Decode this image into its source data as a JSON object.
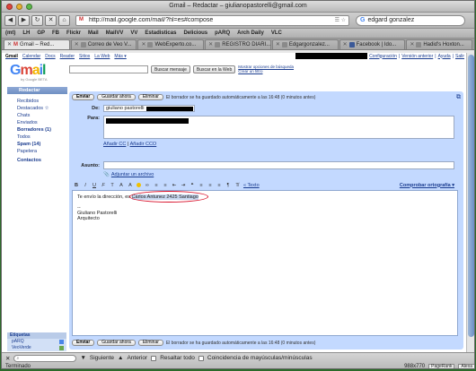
{
  "window": {
    "title": "Gmail – Redactar – giulianopastorelli@gmail.com"
  },
  "toolbar": {
    "url": "http://mail.google.com/mail/?hl=es#compose",
    "search_value": "edgard gonzalez"
  },
  "bookmarks": [
    "(mt)",
    "LH",
    "GP",
    "FB",
    "Flickr",
    "Mail",
    "MailVV",
    "VV",
    "Estadisticas",
    "Delicious",
    "pARQ",
    "Arch Daily",
    "VLC"
  ],
  "tabs": [
    {
      "label": "Gmail – Red...",
      "active": true
    },
    {
      "label": "Correo de Veo V..."
    },
    {
      "label": "WebExperto.co..."
    },
    {
      "label": "REGISTRO DIARI..."
    },
    {
      "label": "Edgargonzalez..."
    },
    {
      "label": "Facebook | Ido..."
    },
    {
      "label": "Hadid's Hoxton..."
    }
  ],
  "gmail_topnav": {
    "items": [
      "Gmail",
      "Calendar",
      "Docs",
      "Reader",
      "Sitios",
      "La Web",
      "Más ▾"
    ],
    "right_links": [
      "Configuración",
      "Versión anterior",
      "Ayuda",
      "Salir"
    ]
  },
  "gmail_search": {
    "search_mail_label": "Buscar mensaje",
    "search_web_label": "Buscar en la Web",
    "show_options": "Mostrar opciones de búsqueda",
    "create_filter": "Crear un filtro"
  },
  "logo": {
    "sub": "by Google BETA"
  },
  "sidebar": {
    "compose": "Redactar",
    "items": [
      {
        "label": "Recibidos",
        "bold": false
      },
      {
        "label": "Destacados ☆",
        "bold": false
      },
      {
        "label": "Chats",
        "bold": false
      },
      {
        "label": "Enviados",
        "bold": false
      },
      {
        "label": "Borradores (1)",
        "bold": true
      },
      {
        "label": "Todos",
        "bold": false
      },
      {
        "label": "Spam (14)",
        "bold": true
      },
      {
        "label": "Papelera",
        "bold": false
      },
      {
        "label": "Contactos",
        "bold": true
      }
    ],
    "labels_header": "Etiquetas",
    "labels": [
      {
        "name": "pARQ",
        "color": "#4a86e8"
      },
      {
        "name": "VeoVerde",
        "color": "#6aa84f"
      }
    ]
  },
  "compose": {
    "send": "Enviar",
    "save": "Guardar ahora",
    "discard": "Eliminar",
    "draft_status": "El borrador se ha guardado automáticamente a las 16:48 (0 minutos antes)",
    "from_label": "De:",
    "from_value": "giuliano pastorelli",
    "to_label": "Para:",
    "add_cc": "Añadir CC",
    "add_bcc": "Añadir CCO",
    "subject_label": "Asunto:",
    "attach": "Adjuntar un archivo",
    "plain_text": "« Texto",
    "spellcheck": "Comprobar ortografía ▾",
    "body_intro": "Te envío la dirección, es",
    "body_address": "Carlos Antunez 2425 Santiago",
    "signature_dash": "--",
    "signature_name": "Giuliano Pastorelli",
    "signature_role": "Arquitecto"
  },
  "findbar": {
    "next": "Siguiente",
    "prev": "Anterior",
    "highlight_all": "Resaltar todo",
    "match_case": "Coincidencia de mayúsculas/minúsculas"
  },
  "status": {
    "text": "Terminado",
    "size": "988x770",
    "pagerank": "PageRank",
    "alexa": "Alexa"
  }
}
